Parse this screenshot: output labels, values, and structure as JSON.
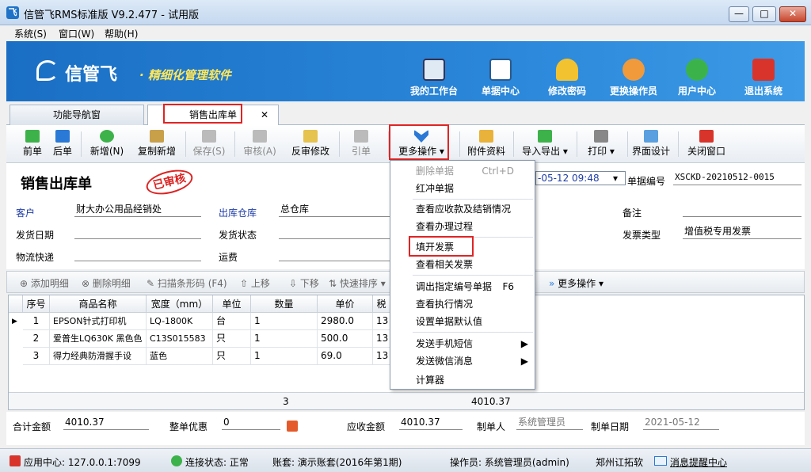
{
  "window": {
    "title": "信管飞RMS标准版 V9.2.477 - 试用版",
    "min": "—",
    "max": "□",
    "close": "✕"
  },
  "menu": {
    "items": [
      "系统(S)",
      "窗口(W)",
      "帮助(H)"
    ]
  },
  "banner": {
    "logo": "信管飞",
    "slogan": "· 精细化管理软件",
    "buttons": [
      "我的工作台",
      "单据中心",
      "修改密码",
      "更换操作员",
      "用户中心",
      "退出系统"
    ]
  },
  "tabs": {
    "nav": "功能导航窗",
    "sale": "销售出库单",
    "close": "✕"
  },
  "toolbar": [
    "前单",
    "后单",
    "新增(N)",
    "复制新增",
    "保存(S)",
    "审核(A)",
    "反审修改",
    "引单",
    "更多操作",
    "附件资料",
    "导入导出",
    "打印",
    "界面设计",
    "关闭窗口"
  ],
  "form": {
    "title": "销售出库单",
    "stamp": "已审核",
    "labels": {
      "customer": "客户",
      "warehouse": "出库仓库",
      "remark": "备注",
      "ship_date": "发货日期",
      "ship_status": "发货状态",
      "invoice_type": "发票类型",
      "logistics": "物流快递",
      "freight": "运费",
      "bill_no": "单据编号"
    },
    "values": {
      "customer": "财大办公用品经销处",
      "warehouse": "总仓库",
      "date": "-05-12 09:48",
      "bill_no": "XSCKD-20210512-0015",
      "invoice_type": "增值税专用发票"
    }
  },
  "detail_toolbar": [
    "添加明细",
    "删除明细",
    "扫描条形码 (F4)",
    "上移",
    "下移",
    "快速排序",
    "更多操作"
  ],
  "grid": {
    "headers": [
      "序号",
      "商品名称",
      "宽度（mm）",
      "单位",
      "数量",
      "单价",
      "税"
    ],
    "rows": [
      {
        "no": "1",
        "name": "EPSON针式打印机",
        "spec": "LQ-1800K",
        "unit": "台",
        "qty": "1",
        "price": "2980.0",
        "tax": "13"
      },
      {
        "no": "2",
        "name": "爱普生LQ630K 黑色色",
        "spec": "C13S015583",
        "unit": "只",
        "qty": "1",
        "price": "500.0",
        "tax": "13"
      },
      {
        "no": "3",
        "name": "得力经典防滑握手设",
        "spec": "蓝色",
        "unit": "只",
        "qty": "1",
        "price": "69.0",
        "tax": "13"
      }
    ],
    "sum_qty": "3",
    "sum_amount": "4010.37"
  },
  "totals": {
    "total_label": "合计金额",
    "total": "4010.37",
    "discount_label": "整单优惠",
    "discount": "0",
    "receivable_label": "应收金额",
    "receivable": "4010.37",
    "maker_label": "制单人",
    "maker": "系统管理员",
    "date_label": "制单日期",
    "date": "2021-05-12"
  },
  "status": {
    "app_center": "应用中心: 127.0.0.1:7099",
    "conn": "连接状态: 正常",
    "account": "账套: 演示账套(2016年第1期)",
    "operator": "操作员: 系统管理员(admin)",
    "company": "郑州讧拓软",
    "msg": "消息提醒中心"
  },
  "dropdown": {
    "items": [
      {
        "label": "删除单据",
        "shortcut": "Ctrl+D",
        "disabled": true
      },
      {
        "label": "红冲单据"
      },
      {
        "label": "查看应收款及结销情况"
      },
      {
        "label": "查看办理过程"
      },
      {
        "label": "填开发票"
      },
      {
        "label": "查看相关发票"
      },
      {
        "label": "调出指定编号单据",
        "shortcut": "F6"
      },
      {
        "label": "查看执行情况"
      },
      {
        "label": "设置单据默认值"
      },
      {
        "label": "发送手机短信",
        "arrow": "▶"
      },
      {
        "label": "发送微信消息",
        "arrow": "▶"
      },
      {
        "label": "计算器"
      }
    ]
  },
  "colors": {
    "banner": "#1a6fc4",
    "slogan": "#ffe75a",
    "highlight": "#e02424",
    "label_blue": "#1e3da8"
  }
}
